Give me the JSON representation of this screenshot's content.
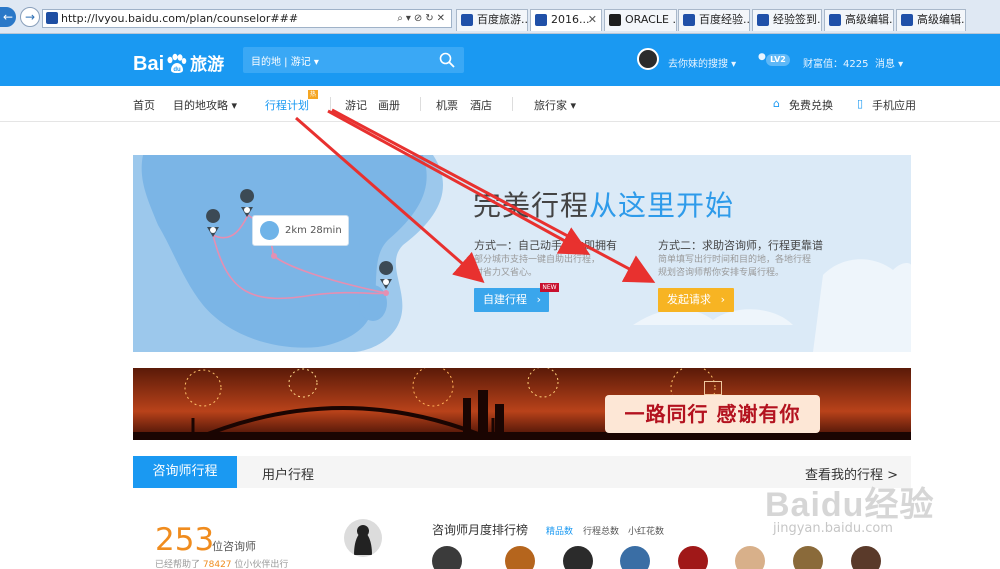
{
  "browser": {
    "url": "http://lvyou.baidu.com/plan/counselor###",
    "tabs": [
      {
        "label": "百度旅游..."
      },
      {
        "label": "2016..."
      },
      {
        "label": "ORACLE ..."
      },
      {
        "label": "百度经验..."
      },
      {
        "label": "经验签到..."
      },
      {
        "label": "高级编辑..."
      },
      {
        "label": "高级编辑..."
      }
    ]
  },
  "header": {
    "logo_text_left": "Bai",
    "logo_text_right": "du",
    "logo_product": "旅游",
    "search_selector": "目的地 | 游记 ▾",
    "username": "去你妹的搜搜 ▾",
    "level": "LV2",
    "wealth": "财富值：4225",
    "messages": "消息 ▾"
  },
  "nav": {
    "items": [
      "首页",
      "目的地攻略 ▾",
      "行程计划",
      "游记",
      "画册",
      "机票",
      "酒店",
      "旅行家 ▾"
    ],
    "hot_badge": "热",
    "free_exchange": "免费兑换",
    "mobile_app": "手机应用"
  },
  "banner": {
    "title_a": "完美行程",
    "title_b": "从这里开始",
    "route_card": "2km 28min",
    "mode1_title": "方式一：自己动手，立即拥有",
    "mode1_desc1": "部分城市支持一键自助出行程，",
    "mode1_desc2": "时省力又省心。",
    "mode1_button": "自建行程",
    "new_tag": "NEW",
    "mode2_title": "方式二：求助咨询师，行程更靠谱",
    "mode2_desc1": "简单填写出行时间和目的地，各地行程",
    "mode2_desc2": "规划咨询师帮你安排专属行程。",
    "mode2_button": "发起请求"
  },
  "promo": {
    "text": "一路同行 感谢有你"
  },
  "tabs": {
    "consultant": "咨询师行程",
    "user": "用户行程",
    "view_mine": "查看我的行程 >"
  },
  "stats": {
    "count": "253",
    "count_unit": "位咨询师",
    "helped_prefix": "已经帮助了",
    "helped_number": "78427",
    "helped_suffix": "位小伙伴出行"
  },
  "ranking": {
    "title": "咨询师月度排行榜",
    "options": [
      "精品数",
      "行程总数",
      "小红花数"
    ]
  },
  "watermark": {
    "brand": "Baidu经验",
    "url": "jingyan.baidu.com"
  },
  "colors": {
    "brand_blue": "#1a99f2",
    "accent_orange": "#f7b423",
    "annotation_red": "#e8312f"
  }
}
